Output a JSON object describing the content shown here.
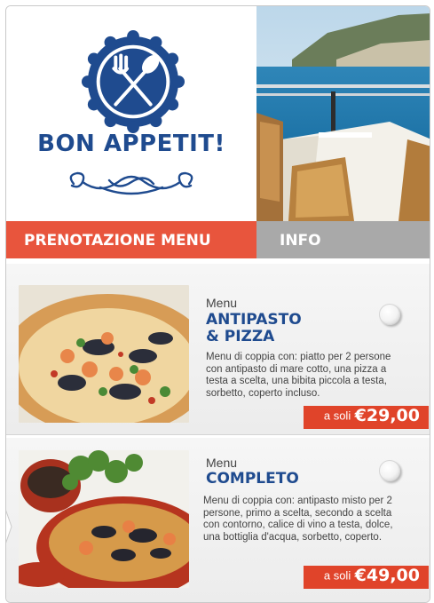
{
  "brand": {
    "title": "BON APPETIT!",
    "logo_icon": "fork-and-spoon-icon",
    "colors": {
      "navy": "#1f4b8f",
      "accent": "#e8553d",
      "gray_tab": "#a9a9a9",
      "price_bg": "#e0442a"
    }
  },
  "tabs": [
    {
      "label": "PRENOTAZIONE MENU",
      "active": true
    },
    {
      "label": "INFO",
      "active": false
    }
  ],
  "menus": [
    {
      "label": "Menu",
      "title_line1": "ANTIPASTO",
      "title_line2": "& PIZZA",
      "description": "Menu di coppia con: piatto per 2 persone con antipasto di mare cotto, una pizza a testa a scelta, una bibita piccola a testa, sorbetto, coperto incluso.",
      "price_prefix": "a soli",
      "price": "€29,00",
      "selected": false
    },
    {
      "label": "Menu",
      "title_line1": "COMPLETO",
      "description": "Menu di coppia con: antipasto misto per 2 persone, primo a scelta, secondo a scelta con contorno, calice di vino a testa, dolce, una bottiglia d'acqua, sorbetto, coperto.",
      "price_prefix": "a soli",
      "price": "€49,00",
      "selected": false
    }
  ]
}
